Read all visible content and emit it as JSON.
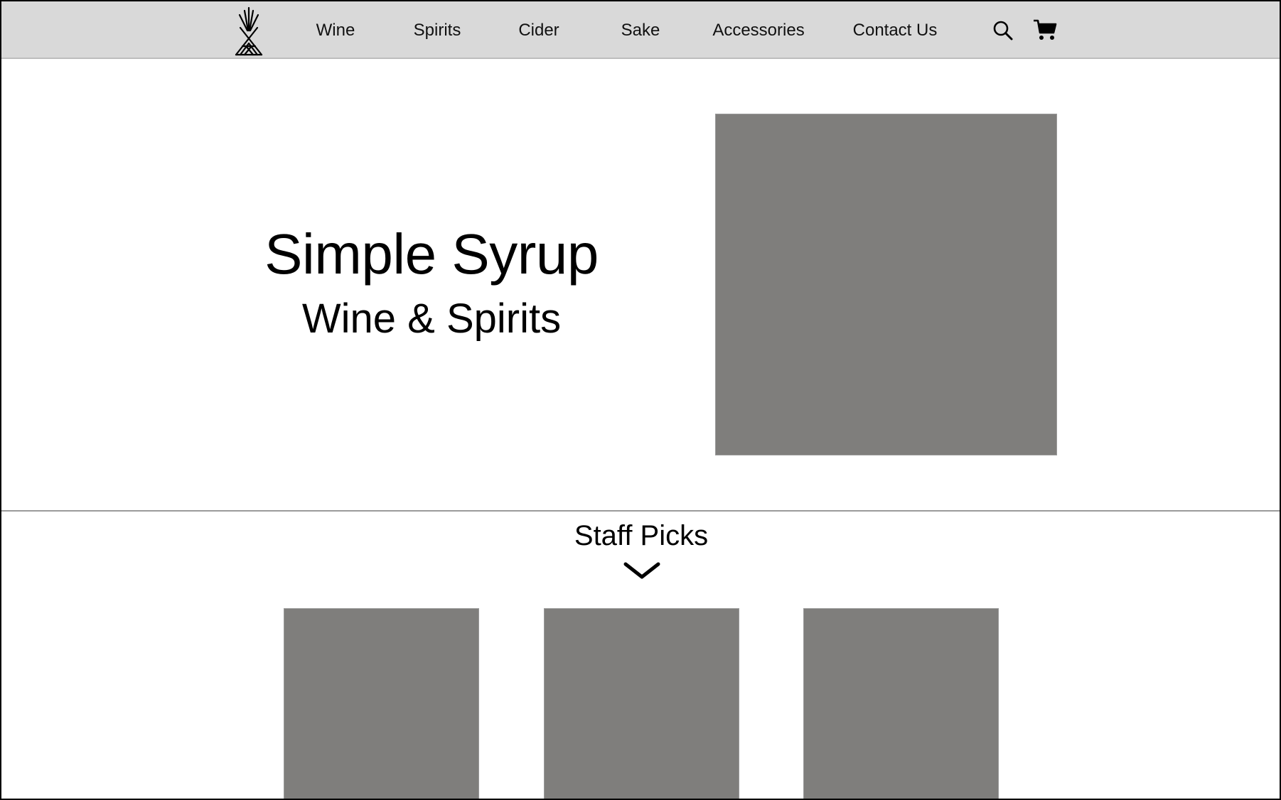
{
  "nav": {
    "logo_icon": "wheat-sheaf-logo-icon",
    "links": [
      "Wine",
      "Spirits",
      "Cider",
      "Sake",
      "Accessories",
      "Contact Us"
    ],
    "search_icon": "search-icon",
    "cart_icon": "cart-icon"
  },
  "hero": {
    "title": "Simple Syrup",
    "subtitle": "Wine & Spirits",
    "image": "placeholder-image"
  },
  "staff_picks": {
    "heading": "Staff Picks",
    "expand_icon": "chevron-down-icon",
    "cards": [
      "placeholder-image",
      "placeholder-image",
      "placeholder-image"
    ]
  },
  "colors": {
    "nav_background": "#d9d9d9",
    "placeholder": "#7f7e7c",
    "text": "#000000"
  }
}
